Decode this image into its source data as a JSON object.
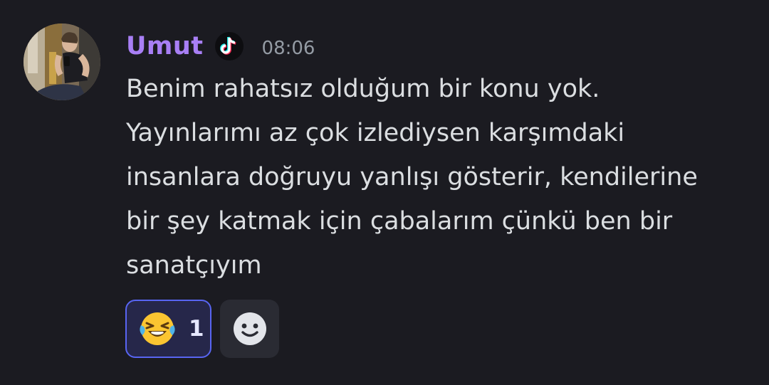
{
  "message": {
    "author": {
      "username": "Umut",
      "name_color": "#a87ff5",
      "avatar_icon": "user-avatar-photo",
      "role_badge_icon": "tiktok-icon"
    },
    "timestamp": "08:06",
    "content_lines": [
      "Benim rahatsız olduğum bir konu yok.",
      "Yayınlarımı az çok izlediysen karşımdaki",
      "insanlara doğruyu yanlışı gösterir, kendilerine",
      "bir şey katmak için çabalarım çünkü ben bir",
      "sanatçıyım"
    ],
    "reactions": [
      {
        "emoji_icon": "rolling-on-the-floor-laughing-icon",
        "count": "1",
        "active": true
      }
    ],
    "add_reaction_icon": "smiley-add-reaction-icon"
  },
  "colors": {
    "background": "#1b1b21",
    "text": "#dbdee1",
    "timestamp": "#949ba4",
    "reaction_active_bg": "#26274a",
    "reaction_active_border": "#5865f2",
    "add_reaction_bg": "#2a2b33"
  }
}
